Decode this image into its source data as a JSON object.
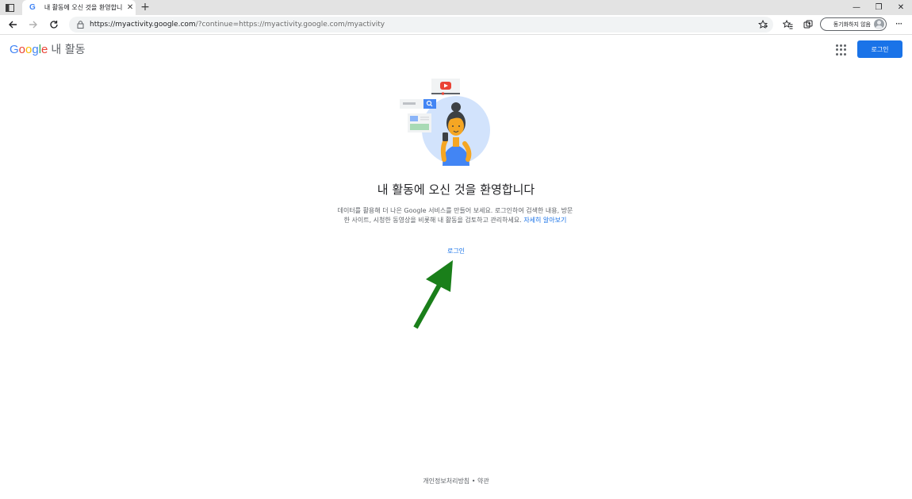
{
  "browser": {
    "tab": {
      "favicon": "G",
      "title": "내 활동에 오신 것을 환영합니다",
      "close_glyph": "✕"
    },
    "new_tab_glyph": "+",
    "window_controls": {
      "minimize": "—",
      "restore": "❐",
      "close": "✕"
    },
    "url": {
      "scheme": "https://",
      "host": "myactivity.google.com",
      "rest": "/?continue=https://myactivity.google.com/myactivity"
    },
    "profile": {
      "label": "동기화하지 않음"
    },
    "more_glyph": "···"
  },
  "header": {
    "logo_letters": [
      {
        "ch": "G",
        "color": "#4285f4"
      },
      {
        "ch": "o",
        "color": "#ea4335"
      },
      {
        "ch": "o",
        "color": "#fbbc05"
      },
      {
        "ch": "g",
        "color": "#4285f4"
      },
      {
        "ch": "l",
        "color": "#34a853"
      },
      {
        "ch": "e",
        "color": "#ea4335"
      }
    ],
    "product_name": "내 활동",
    "signin_button": "로그인"
  },
  "main": {
    "title": "내 활동에 오신 것을 환영합니다",
    "description": "데이터를 활용해 더 나은 Google 서비스를 만들어 보세요. 로그인하여 검색한 내용, 방문한 사이트, 시청한 동영상을 비롯해 내 활동을 검토하고 관리하세요.",
    "learn_more": "자세히 알아보기",
    "signin_link": "로그인"
  },
  "footer": {
    "privacy": "개인정보처리방침",
    "separator": "•",
    "terms": "약관"
  },
  "colors": {
    "accent": "#1a73e8",
    "annotation_arrow": "#1a7f1a"
  }
}
